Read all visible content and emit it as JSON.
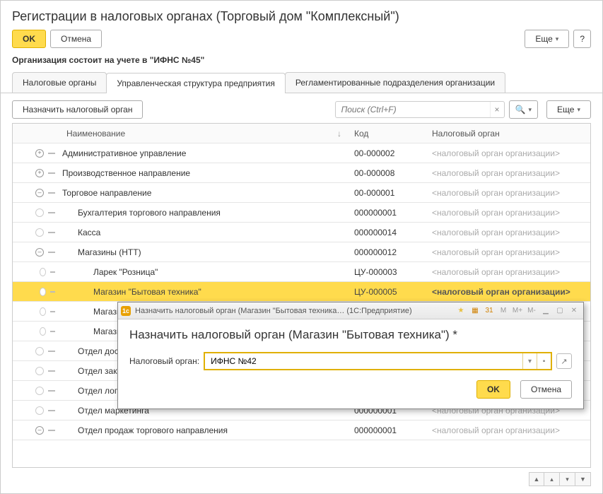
{
  "header": {
    "title": "Регистрации в налоговых органах (Торговый дом \"Комплексный\")",
    "ok_label": "OK",
    "cancel_label": "Отмена",
    "more_label": "Еще",
    "help_label": "?",
    "status_text": "Организация состоит на учете в \"ИФНС №45\""
  },
  "tabs": {
    "t1": "Налоговые органы",
    "t2": "Управленческая структура предприятия",
    "t3": "Регламентированные подразделения организации"
  },
  "toolbar": {
    "assign_label": "Назначить налоговый орган",
    "search_placeholder": "Поиск (Ctrl+F)",
    "more_label": "Еще"
  },
  "columns": {
    "name": "Наименование",
    "sort_glyph": "↓",
    "code": "Код",
    "tax": "Налоговый орган"
  },
  "placeholder_tax": "<налоговый орган организации>",
  "rows": [
    {
      "indent": 1,
      "exp": "plus",
      "name": "Административное управление",
      "code": "00-000002"
    },
    {
      "indent": 1,
      "exp": "plus",
      "name": "Производственное направление",
      "code": "00-000008"
    },
    {
      "indent": 1,
      "exp": "minus",
      "name": "Торговое направление",
      "code": "00-000001"
    },
    {
      "indent": 2,
      "exp": "none",
      "name": "Бухгалтерия торгового направления",
      "code": "000000001"
    },
    {
      "indent": 2,
      "exp": "none",
      "name": "Касса",
      "code": "000000014"
    },
    {
      "indent": 2,
      "exp": "minus",
      "name": "Магазины (НТТ)",
      "code": "000000012"
    },
    {
      "indent": 3,
      "exp": "none",
      "name": "Ларек \"Розница\"",
      "code": "ЦУ-000003"
    },
    {
      "indent": 3,
      "exp": "none",
      "name": "Магазин \"Бытовая техника\"",
      "code": "ЦУ-000005",
      "selected": true
    },
    {
      "indent": 3,
      "exp": "none",
      "name": "Магазин",
      "code": ""
    },
    {
      "indent": 3,
      "exp": "none",
      "name": "Магазин",
      "code": ""
    },
    {
      "indent": 2,
      "exp": "none",
      "name": "Отдел дост",
      "code": ""
    },
    {
      "indent": 2,
      "exp": "none",
      "name": "Отдел заку",
      "code": ""
    },
    {
      "indent": 2,
      "exp": "none",
      "name": "Отдел логи",
      "code": ""
    },
    {
      "indent": 2,
      "exp": "none",
      "name": "Отдел маркетинга",
      "code": "000000001"
    },
    {
      "indent": 2,
      "exp": "minus",
      "name": "Отдел продаж торгового направления",
      "code": "000000001"
    }
  ],
  "dialog": {
    "titlebar_text": "Назначить налоговый орган (Магазин \"Бытовая техника…   (1С:Предприятие)",
    "heading": "Назначить налоговый орган (Магазин \"Бытовая техника\") *",
    "field_label": "Налоговый орган:",
    "field_value": "ИФНС №42",
    "ok_label": "OK",
    "cancel_label": "Отмена",
    "tb_m": "M",
    "tb_mplus": "M+",
    "tb_mminus": "M-"
  }
}
